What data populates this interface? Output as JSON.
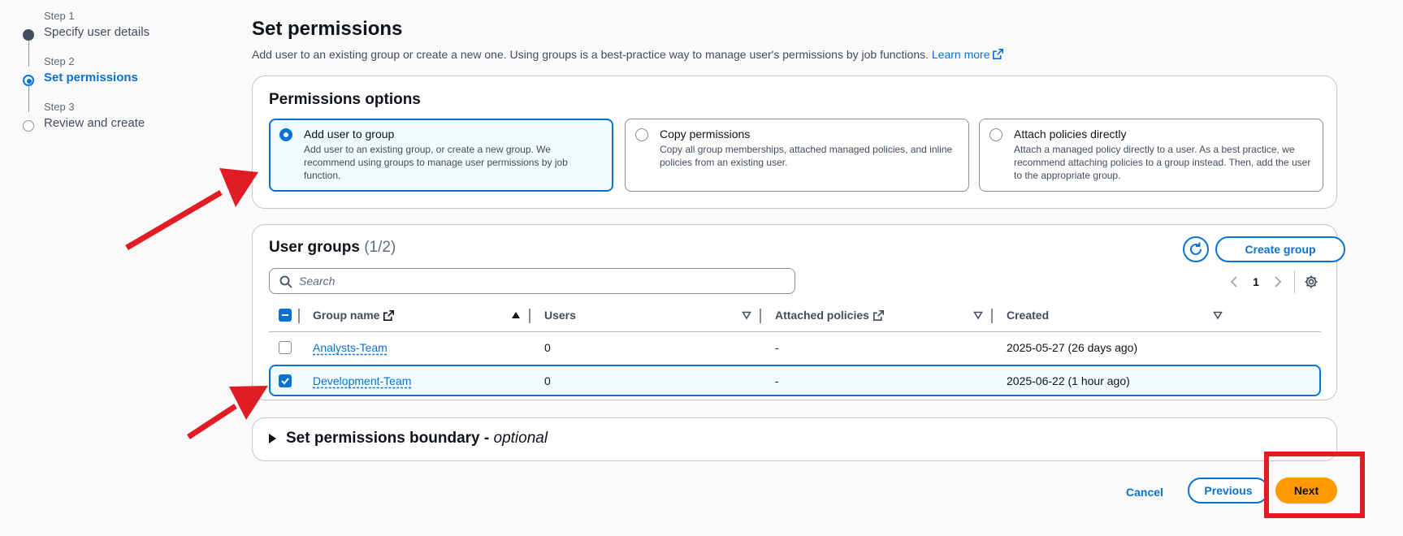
{
  "stepper": {
    "steps": [
      {
        "num": "Step 1",
        "title": "Specify user details"
      },
      {
        "num": "Step 2",
        "title": "Set permissions"
      },
      {
        "num": "Step 3",
        "title": "Review and create"
      }
    ]
  },
  "header": {
    "title": "Set permissions",
    "description": "Add user to an existing group or create a new one. Using groups is a best-practice way to manage user's permissions by job functions.",
    "learn_more": "Learn more"
  },
  "permissions_options": {
    "title": "Permissions options",
    "options": [
      {
        "title": "Add user to group",
        "desc": "Add user to an existing group, or create a new group. We recommend using groups to manage user permissions by job function.",
        "selected": true
      },
      {
        "title": "Copy permissions",
        "desc": "Copy all group memberships, attached managed policies, and inline policies from an existing user.",
        "selected": false
      },
      {
        "title": "Attach policies directly",
        "desc": "Attach a managed policy directly to a user. As a best practice, we recommend attaching policies to a group instead. Then, add the user to the appropriate group.",
        "selected": false
      }
    ]
  },
  "user_groups": {
    "title": "User groups",
    "count": "(1/2)",
    "create_label": "Create group",
    "search_placeholder": "Search",
    "page": "1",
    "columns": [
      "Group name",
      "Users",
      "Attached policies",
      "Created"
    ],
    "rows": [
      {
        "name": "Analysts-Team",
        "users": "0",
        "policies": "-",
        "created": "2025-05-27 (26 days ago)",
        "checked": false
      },
      {
        "name": "Development-Team",
        "users": "0",
        "policies": "-",
        "created": "2025-06-22 (1 hour ago)",
        "checked": true
      }
    ]
  },
  "boundary": {
    "title": "Set permissions boundary",
    "dash": " - ",
    "optional": "optional"
  },
  "footer": {
    "cancel": "Cancel",
    "previous": "Previous",
    "next": "Next"
  },
  "colors": {
    "accent": "#0972d3",
    "primary_button": "#ff9900",
    "annotation": "#e01c24"
  }
}
